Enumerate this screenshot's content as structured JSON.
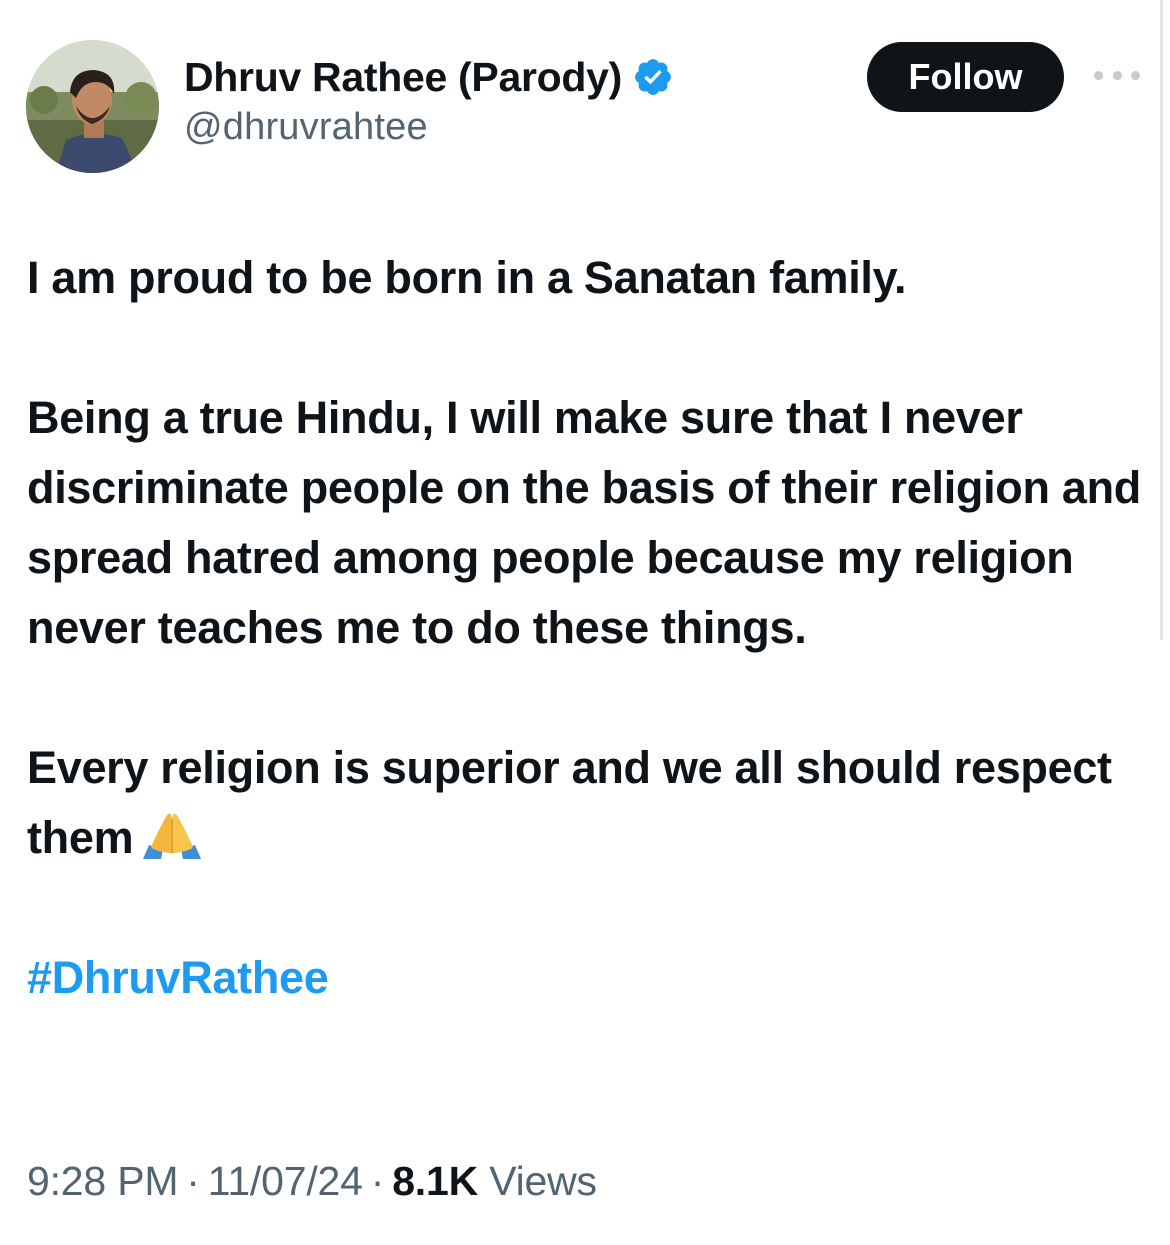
{
  "author": {
    "display_name": "Dhruv Rathee (Parody)",
    "handle": "@dhruvrahtee",
    "verified": true
  },
  "actions": {
    "follow_label": "Follow"
  },
  "tweet": {
    "paragraph_1": "I am proud to be born in a Sanatan family.",
    "paragraph_2": "Being a true Hindu, I will make sure that I never discriminate people on the basis of their religion and spread hatred among people because my religion never teaches me to do these things.",
    "paragraph_3": "Every religion is superior and we all should respect them",
    "emoji": "folded-hands",
    "hashtag": "#DhruvRathee"
  },
  "meta": {
    "time": "9:28 PM",
    "separator": "·",
    "date": "11/07/24",
    "views_count": "8.1K",
    "views_label": "Views"
  },
  "colors": {
    "text": "#0f1419",
    "secondary": "#536471",
    "link": "#1d9bf0",
    "verified": "#1d9bf0"
  }
}
